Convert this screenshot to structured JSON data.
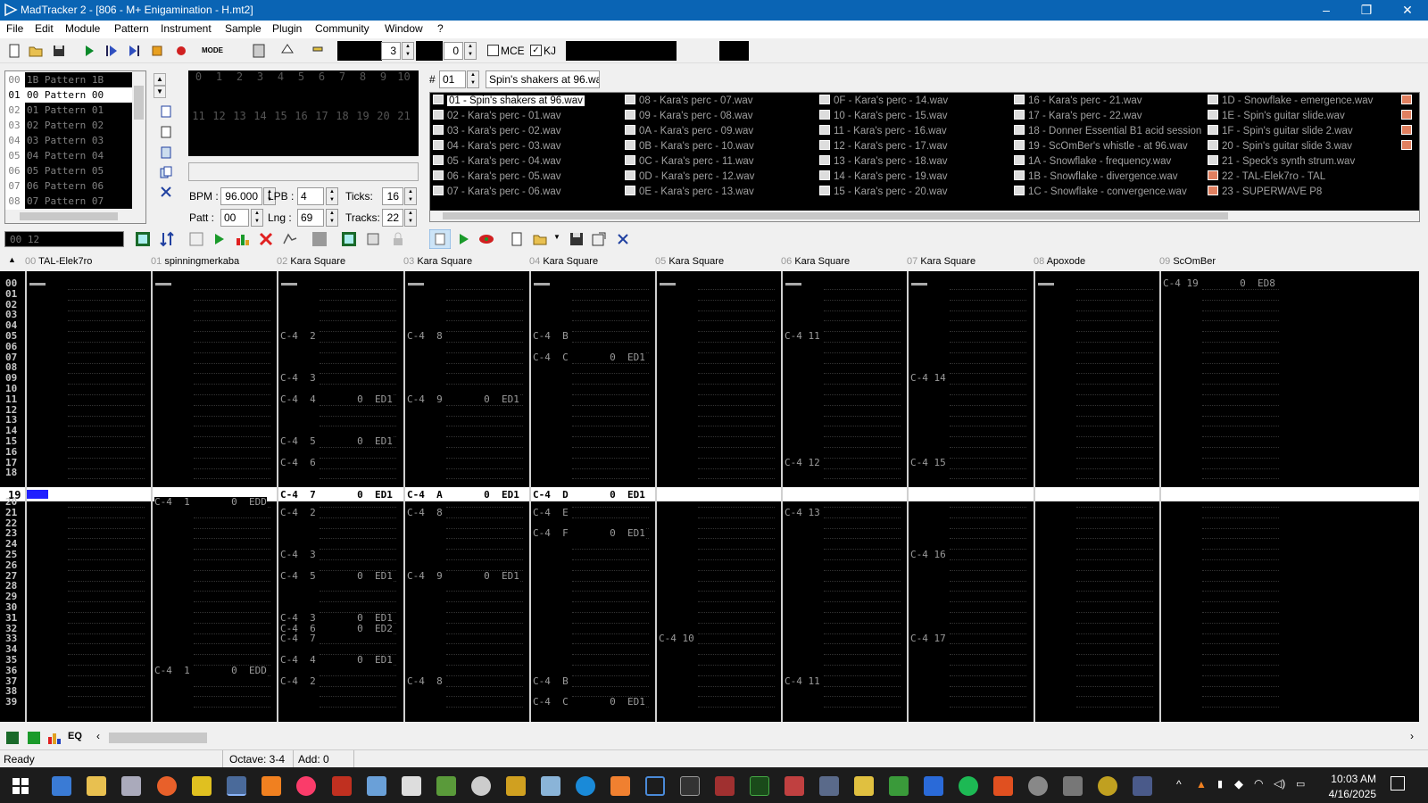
{
  "window": {
    "title": "MadTracker 2 - [806 - M+ Enigamination - H.mt2]",
    "minimize": "–",
    "maximize": "❐",
    "close": "✕"
  },
  "menu": [
    "File",
    "Edit",
    "Module",
    "Pattern",
    "Instrument",
    "Sample",
    "Plugin",
    "Community",
    "Window",
    "?"
  ],
  "toolbar": {
    "octave_value": "3",
    "add_value": "0",
    "mce_label": "MCE",
    "kj_label": "KJ",
    "mode_label": "MODE"
  },
  "patterns": [
    {
      "num": "00",
      "name": "1B Pattern 1B"
    },
    {
      "num": "01",
      "name": "00 Pattern 00",
      "selected": true
    },
    {
      "num": "02",
      "name": "01 Pattern 01"
    },
    {
      "num": "03",
      "name": "02 Pattern 02"
    },
    {
      "num": "04",
      "name": "03 Pattern 03"
    },
    {
      "num": "05",
      "name": "04 Pattern 04"
    },
    {
      "num": "06",
      "name": "05 Pattern 05"
    },
    {
      "num": "07",
      "name": "06 Pattern 06"
    },
    {
      "num": "08",
      "name": "07 Pattern 07"
    }
  ],
  "order_grid": {
    "row1": [
      "0",
      "1",
      "2",
      "3",
      "4",
      "5",
      "6",
      "7",
      "8",
      "9",
      "10"
    ],
    "row2": [
      "11",
      "12",
      "13",
      "14",
      "15",
      "16",
      "17",
      "18",
      "19",
      "20",
      "21"
    ]
  },
  "song": {
    "bpm_label": "BPM :",
    "bpm": "96.000",
    "lpb_label": "LPB :",
    "lpb": "4",
    "ticks_label": "Ticks:",
    "ticks": "16",
    "patt_label": "Patt :",
    "patt": "00",
    "lng_label": "Lng :",
    "lng": "69",
    "tracks_label": "Tracks:",
    "tracks": "22"
  },
  "position_display": "00 12",
  "sample_editor": {
    "hash": "#",
    "index": "01",
    "name": "Spin's shakers at 96.wav"
  },
  "samples": [
    [
      "01 - Spin's shakers at 96.wav",
      "02 - Kara's perc - 01.wav",
      "03 - Kara's perc - 02.wav",
      "04 - Kara's perc - 03.wav",
      "05 - Kara's perc - 04.wav",
      "06 - Kara's perc - 05.wav",
      "07 - Kara's perc - 06.wav"
    ],
    [
      "08 - Kara's perc - 07.wav",
      "09 - Kara's perc - 08.wav",
      "0A - Kara's perc - 09.wav",
      "0B - Kara's perc - 10.wav",
      "0C - Kara's perc - 11.wav",
      "0D - Kara's perc - 12.wav",
      "0E - Kara's perc - 13.wav"
    ],
    [
      "0F - Kara's perc - 14.wav",
      "10 - Kara's perc - 15.wav",
      "11 - Kara's perc - 16.wav",
      "12 - Kara's perc - 17.wav",
      "13 - Kara's perc - 18.wav",
      "14 - Kara's perc - 19.wav",
      "15 - Kara's perc - 20.wav"
    ],
    [
      "16 - Kara's perc - 21.wav",
      "17 - Kara's perc - 22.wav",
      "18 - Donner Essential B1 acid session",
      "19 - ScOmBer's whistle - at 96.wav",
      "1A - Snowflake - frequency.wav",
      "1B - Snowflake - divergence.wav",
      "1C - Snowflake - convergence.wav"
    ],
    [
      "1D - Snowflake - emergence.wav",
      "1E - Spin's guitar slide.wav",
      "1F - Spin's guitar slide 2.wav",
      "20 - Spin's guitar slide 3.wav",
      "21 - Speck's synth strum.wav",
      "22 - TAL-Elek7ro - TAL",
      "23 - SUPERWAVE P8"
    ]
  ],
  "tracks": [
    {
      "num": "00",
      "name": "TAL-Elek7ro"
    },
    {
      "num": "01",
      "name": "spinningmerkaba"
    },
    {
      "num": "02",
      "name": "Kara Square"
    },
    {
      "num": "03",
      "name": "Kara Square"
    },
    {
      "num": "04",
      "name": "Kara Square"
    },
    {
      "num": "05",
      "name": "Kara Square"
    },
    {
      "num": "06",
      "name": "Kara Square"
    },
    {
      "num": "07",
      "name": "Kara Square"
    },
    {
      "num": "08",
      "name": "Apoxode"
    },
    {
      "num": "09",
      "name": "ScOmBer"
    }
  ],
  "rows_top": [
    "00",
    "01",
    "02",
    "03",
    "04",
    "05",
    "06",
    "07",
    "08",
    "09",
    "10",
    "11",
    "12",
    "13",
    "14",
    "15",
    "16",
    "17",
    "18"
  ],
  "current_row": "19",
  "rows_bottom": [
    "20",
    "21",
    "22",
    "23",
    "24",
    "25",
    "26",
    "27",
    "28",
    "29",
    "30",
    "31",
    "32",
    "33",
    "34",
    "35",
    "36",
    "37",
    "38",
    "39"
  ],
  "pattern_cells": [
    {
      "t": 9,
      "r": 0,
      "v": "C-4 19       0  ED8"
    },
    {
      "t": 2,
      "r": 5,
      "v": "C-4  2"
    },
    {
      "t": 3,
      "r": 5,
      "v": "C-4  8"
    },
    {
      "t": 4,
      "r": 5,
      "v": "C-4  B"
    },
    {
      "t": 6,
      "r": 5,
      "v": "C-4 11"
    },
    {
      "t": 4,
      "r": 7,
      "v": "C-4  C       0  ED1"
    },
    {
      "t": 2,
      "r": 9,
      "v": "C-4  3"
    },
    {
      "t": 7,
      "r": 9,
      "v": "C-4 14"
    },
    {
      "t": 2,
      "r": 11,
      "v": "C-4  4       0  ED1"
    },
    {
      "t": 3,
      "r": 11,
      "v": "C-4  9       0  ED1"
    },
    {
      "t": 2,
      "r": 15,
      "v": "C-4  5       0  ED1"
    },
    {
      "t": 2,
      "r": 17,
      "v": "C-4  6"
    },
    {
      "t": 6,
      "r": 17,
      "v": "C-4 12"
    },
    {
      "t": 7,
      "r": 17,
      "v": "C-4 15"
    },
    {
      "t": 1,
      "r": 20,
      "v": "C-4  1       0  EDD"
    },
    {
      "t": 2,
      "r": 21,
      "v": "C-4  2"
    },
    {
      "t": 3,
      "r": 21,
      "v": "C-4  8"
    },
    {
      "t": 4,
      "r": 21,
      "v": "C-4  E"
    },
    {
      "t": 6,
      "r": 21,
      "v": "C-4 13"
    },
    {
      "t": 4,
      "r": 23,
      "v": "C-4  F       0  ED1"
    },
    {
      "t": 2,
      "r": 25,
      "v": "C-4  3"
    },
    {
      "t": 7,
      "r": 25,
      "v": "C-4 16"
    },
    {
      "t": 2,
      "r": 27,
      "v": "C-4  5       0  ED1"
    },
    {
      "t": 3,
      "r": 27,
      "v": "C-4  9       0  ED1"
    },
    {
      "t": 2,
      "r": 31,
      "v": "C-4  3       0  ED1"
    },
    {
      "t": 2,
      "r": 32,
      "v": "C-4  6       0  ED2"
    },
    {
      "t": 2,
      "r": 33,
      "v": "C-4  7"
    },
    {
      "t": 5,
      "r": 33,
      "v": "C-4 10"
    },
    {
      "t": 7,
      "r": 33,
      "v": "C-4 17"
    },
    {
      "t": 2,
      "r": 35,
      "v": "C-4  4       0  ED1"
    },
    {
      "t": 1,
      "r": 36,
      "v": "C-4  1       0  EDD"
    },
    {
      "t": 2,
      "r": 37,
      "v": "C-4  2"
    },
    {
      "t": 3,
      "r": 37,
      "v": "C-4  8"
    },
    {
      "t": 4,
      "r": 37,
      "v": "C-4  B"
    },
    {
      "t": 6,
      "r": 37,
      "v": "C-4 11"
    },
    {
      "t": 4,
      "r": 39,
      "v": "C-4  C       0  ED1"
    }
  ],
  "current_row_cells": [
    {
      "t": 2,
      "v": "C-4  7       0  ED1"
    },
    {
      "t": 3,
      "v": "C-4  A       0  ED1"
    },
    {
      "t": 4,
      "v": "C-4  D       0  ED1"
    }
  ],
  "status": {
    "ready": "Ready",
    "octave": "Octave: 3-4",
    "add": "Add: 0"
  },
  "clock": {
    "time": "10:03 AM",
    "date": "4/16/2025"
  },
  "colors": {
    "titlebar": "#0a64b4",
    "pattern_bg": "#000000",
    "cursor": "#2020ff"
  }
}
